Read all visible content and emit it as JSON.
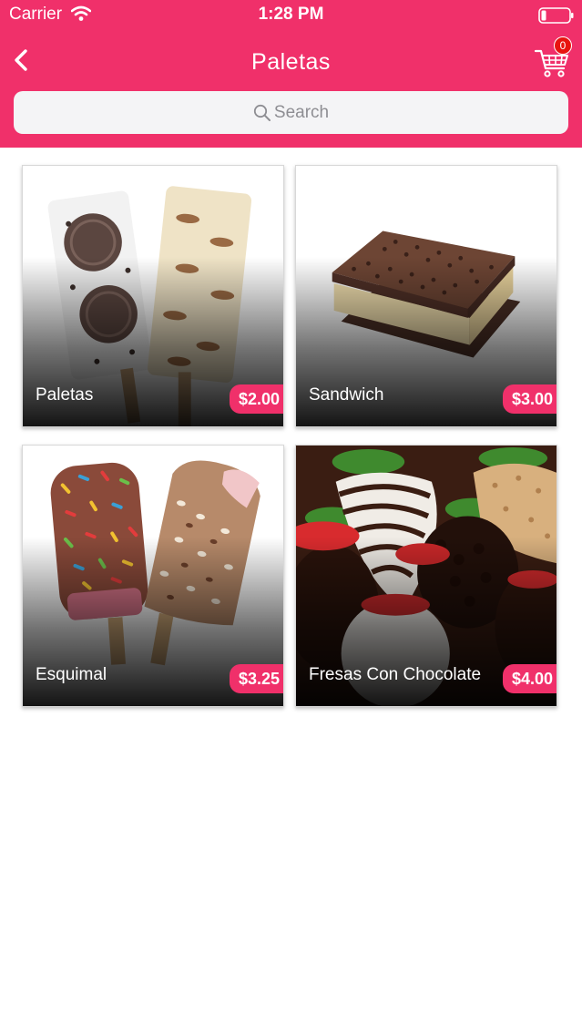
{
  "status_bar": {
    "carrier": "Carrier",
    "time": "1:28 PM"
  },
  "nav": {
    "title": "Paletas",
    "cart_count": "0"
  },
  "search": {
    "placeholder": "Search"
  },
  "colors": {
    "brand": "#f0306a",
    "badge_red": "#e8140f",
    "search_bg": "#f4f4f6"
  },
  "products": [
    {
      "name": "Paletas",
      "price": "$2.00"
    },
    {
      "name": "Sandwich",
      "price": "$3.00"
    },
    {
      "name": "Esquimal",
      "price": "$3.25"
    },
    {
      "name": "Fresas Con Chocolate",
      "price": "$4.00"
    }
  ]
}
